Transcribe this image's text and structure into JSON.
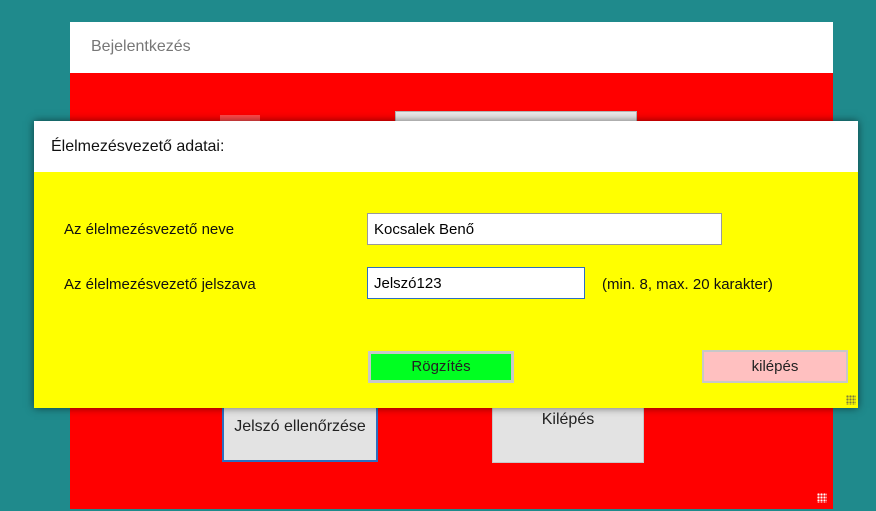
{
  "login_window": {
    "title": "Bejelentkezés",
    "check_password_button": "Jelszó ellenőrzése",
    "exit_button": "Kilépés"
  },
  "dialog": {
    "title": "Élelmezésvezető adatai:",
    "name_label": "Az élelmezésvezető neve",
    "name_value": "Kocsalek Benő",
    "password_label": "Az élelmezésvezető jelszava",
    "password_value": "Jelszó123",
    "password_hint": "(min. 8, max. 20 karakter)",
    "save_button": "Rögzítés",
    "exit_button": "kilépés"
  },
  "colors": {
    "desktop": "#1f8a8c",
    "login_window_background": "#ff0000",
    "dialog_background": "#ffff00",
    "save_button": "#00ff21",
    "dialog_exit_button": "#ffc0c0"
  }
}
